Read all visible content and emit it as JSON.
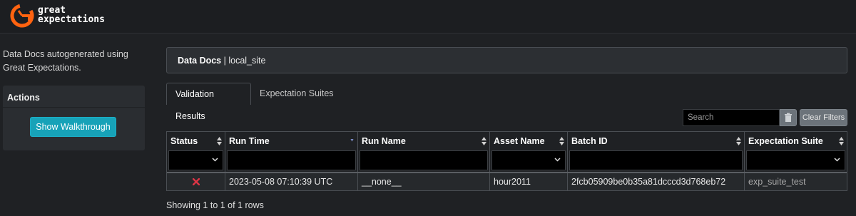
{
  "brand": {
    "line1": "great",
    "line2": "expectations",
    "accent": "#ff6310"
  },
  "sidebar": {
    "description_line1": "Data Docs autogenerated using",
    "description_line2": "Great Expectations.",
    "actions_title": "Actions",
    "walkthrough_label": "Show Walkthrough"
  },
  "breadcrumb": {
    "root": "Data Docs",
    "separator": " | ",
    "site": "local_site"
  },
  "tabs": [
    {
      "label": "Validation Results",
      "active": true
    },
    {
      "label": "Expectation Suites",
      "active": false
    }
  ],
  "toolbar": {
    "search_placeholder": "Search",
    "trash_icon": "trash-icon",
    "clear_label": "Clear Filters"
  },
  "table": {
    "columns": [
      {
        "label": "Status"
      },
      {
        "label": "Run Time"
      },
      {
        "label": "Run Name"
      },
      {
        "label": "Asset Name"
      },
      {
        "label": "Batch ID"
      },
      {
        "label": "Expectation Suite"
      }
    ],
    "rows": [
      {
        "status": "failed",
        "status_icon": "x-icon",
        "run_time": "2023-05-08 07:10:39 UTC",
        "run_name": "__none__",
        "asset_name": "hour2011",
        "batch_id": "2fcb05909be0b35a81dcccd3d768eb72",
        "expectation_suite": "exp_suite_test"
      }
    ],
    "status_fail_color": "#dc3545",
    "footer": "Showing 1 to 1 of 1 rows"
  }
}
